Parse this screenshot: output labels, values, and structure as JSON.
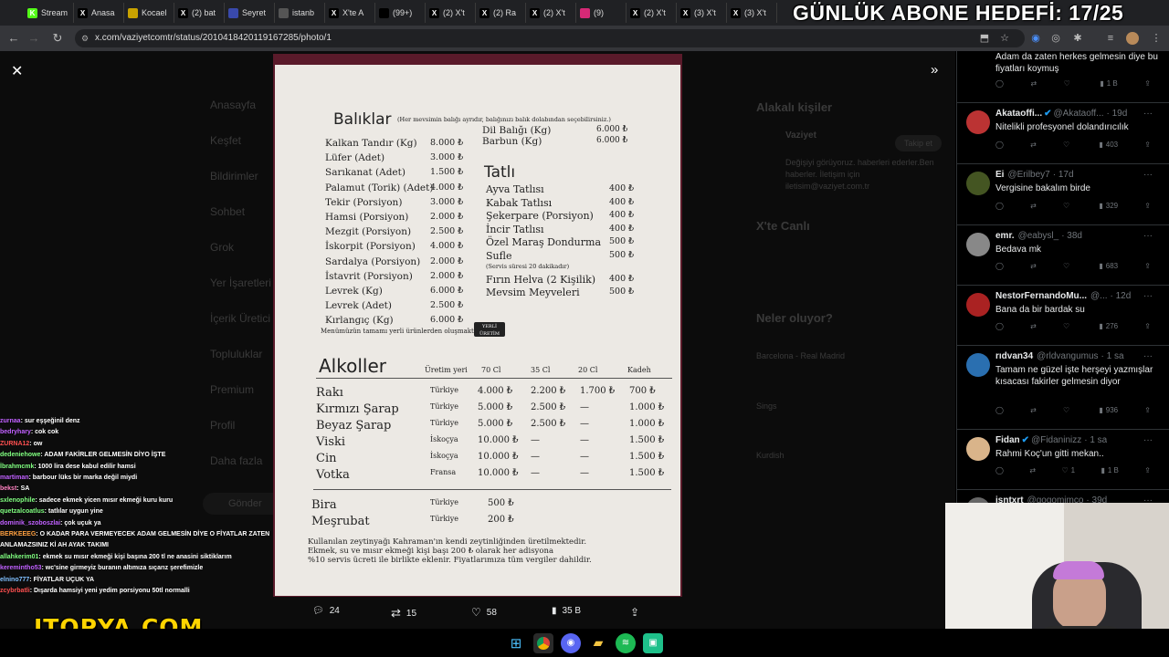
{
  "browser": {
    "tabs": [
      {
        "label": "Stream",
        "icon": "kick-icon",
        "color": "#53fc18"
      },
      {
        "label": "Anasa",
        "icon": "x-icon",
        "color": "#000"
      },
      {
        "label": "Kocael",
        "icon": "shield-icon",
        "color": "#c8a200"
      },
      {
        "label": "(2) bat",
        "icon": "x-icon",
        "color": "#000"
      },
      {
        "label": "Seyret",
        "icon": "globe-icon",
        "color": "#3949ab"
      },
      {
        "label": "istanb",
        "icon": "globe-icon",
        "color": "#555"
      },
      {
        "label": "X'te A",
        "icon": "x-icon",
        "color": "#000"
      },
      {
        "label": "(99+)",
        "icon": "tiktok-icon",
        "color": "#000"
      },
      {
        "label": "(2) X't",
        "icon": "x-icon",
        "color": "#000"
      },
      {
        "label": "(2) Ra",
        "icon": "x-icon",
        "color": "#000"
      },
      {
        "label": "(2) X't",
        "icon": "x-icon",
        "color": "#000"
      },
      {
        "label": "(9)",
        "icon": "instagram-icon",
        "color": "#d62976"
      },
      {
        "label": "(2) X't",
        "icon": "x-icon",
        "color": "#000"
      },
      {
        "label": "(3) X't",
        "icon": "x-icon",
        "color": "#000"
      },
      {
        "label": "(3) X't",
        "icon": "x-icon",
        "color": "#000"
      }
    ],
    "url": "x.com/vaziyetcomtr/status/2010418420119167285/photo/1"
  },
  "overlay_title": "GÜNLÜK ABONE HEDEFİ: 17/25",
  "background": {
    "nav": [
      "Anasayfa",
      "Keşfet",
      "Bildirimler",
      "Sohbet",
      "Grok",
      "Yer İşaretleri",
      "İçerik Üretici",
      "Topluluklar",
      "Premium",
      "Profil",
      "Daha fazla"
    ],
    "post_button": "Gönder",
    "related_title": "Alakalı kişiler",
    "live_title": "X'te Canlı",
    "trends_title": "Neler oluyor?",
    "trend_1": "Barcelona - Real Madrid",
    "trend_2": "Sings",
    "trend_3": "Kurdish",
    "related_name": "Vaziyet",
    "related_desc": "Değişiyi görüyoruz. haberleri ederler.Ben haberler. İletişim için iletisim@vaziyet.com.tr",
    "follow_btn": "Takip et"
  },
  "menu": {
    "fish_title": "Balıklar",
    "fish_note": "(Her mevsimin balığı ayrıdır, balığınızı balık dolabından seçebilirsiniz.)",
    "fish": [
      {
        "name": "Kalkan Tandır (Kg)",
        "price": "8.000 ₺"
      },
      {
        "name": "Lüfer (Adet)",
        "price": "3.000 ₺"
      },
      {
        "name": "Sarıkanat (Adet)",
        "price": "1.500 ₺"
      },
      {
        "name": "Palamut (Torik) (Adet)",
        "price": "4.000 ₺"
      },
      {
        "name": "Tekir (Porsiyon)",
        "price": "3.000 ₺"
      },
      {
        "name": "Hamsi (Porsiyon)",
        "price": "2.000 ₺"
      },
      {
        "name": "Mezgit (Porsiyon)",
        "price": "2.500 ₺"
      },
      {
        "name": "İskorpit (Porsiyon)",
        "price": "4.000 ₺"
      },
      {
        "name": "Sardalya (Porsiyon)",
        "price": "2.000 ₺"
      },
      {
        "name": "İstavrit (Porsiyon)",
        "price": "2.000 ₺"
      },
      {
        "name": "Levrek (Kg)",
        "price": "6.000 ₺"
      },
      {
        "name": "Levrek (Adet)",
        "price": "2.500 ₺"
      },
      {
        "name": "Kırlangıç (Kg)",
        "price": "6.000 ₺"
      }
    ],
    "fish_right": [
      {
        "name": "Dil Balığı (Kg)",
        "price": "6.000 ₺"
      },
      {
        "name": "Barbun (Kg)",
        "price": "6.000 ₺"
      }
    ],
    "dessert_title": "Tatlı",
    "desserts": [
      {
        "name": "Ayva Tatlısı",
        "price": "400 ₺"
      },
      {
        "name": "Kabak Tatlısı",
        "price": "400 ₺"
      },
      {
        "name": "Şekerpare (Porsiyon)",
        "price": "400 ₺"
      },
      {
        "name": "İncir Tatlısı",
        "price": "400 ₺"
      },
      {
        "name": "Özel Maraş Dondurma",
        "price": "500 ₺"
      },
      {
        "name": "Sufle",
        "price": "500 ₺"
      },
      {
        "name": "(Servis süresi 20 dakikadır)",
        "price": ""
      },
      {
        "name": "Fırın Helva (2 Kişilik)",
        "price": "400 ₺"
      },
      {
        "name": "Mevsim Meyveleri",
        "price": "500 ₺"
      }
    ],
    "local_note": "Menümüzün tamamı yerli ürünlerden oluşmaktadır.",
    "local_badge": "YERLİ ÜRETİM",
    "alcohol_title": "Alkoller",
    "alcohol_headers": [
      "Üretim yeri",
      "70 Cl",
      "35 Cl",
      "20 Cl",
      "Kadeh"
    ],
    "alcohol": [
      {
        "name": "Rakı",
        "origin": "Türkiye",
        "c70": "4.000 ₺",
        "c35": "2.200 ₺",
        "c20": "1.700 ₺",
        "glass": "700 ₺"
      },
      {
        "name": "Kırmızı Şarap",
        "origin": "Türkiye",
        "c70": "5.000 ₺",
        "c35": "2.500 ₺",
        "c20": "—",
        "glass": "1.000 ₺"
      },
      {
        "name": "Beyaz Şarap",
        "origin": "Türkiye",
        "c70": "5.000 ₺",
        "c35": "2.500 ₺",
        "c20": "—",
        "glass": "1.000 ₺"
      },
      {
        "name": "Viski",
        "origin": "İskoçya",
        "c70": "10.000 ₺",
        "c35": "—",
        "c20": "—",
        "glass": "1.500 ₺"
      },
      {
        "name": "Cin",
        "origin": "İskoçya",
        "c70": "10.000 ₺",
        "c35": "—",
        "c20": "—",
        "glass": "1.500 ₺"
      },
      {
        "name": "Votka",
        "origin": "Fransa",
        "c70": "10.000 ₺",
        "c35": "—",
        "c20": "—",
        "glass": "1.500 ₺"
      }
    ],
    "drinks": [
      {
        "name": "Bira",
        "origin": "Türkiye",
        "price": "500 ₺"
      },
      {
        "name": "Meşrubat",
        "origin": "Türkiye",
        "price": "200 ₺"
      }
    ],
    "footer": [
      "Kullanılan zeytinyağı Kahraman'ın kendi zeytinliğinden üretilmektedir.",
      "Ekmek, su ve mısır ekmeği kişi başı 200 ₺ olarak her adisyona",
      "%10 servis ücreti ile birlikte eklenir. Fiyatlarımıza tüm vergiler dahildir."
    ]
  },
  "post_actions": {
    "replies": "24",
    "reposts": "15",
    "likes": "58",
    "views": "35 B"
  },
  "replies": [
    {
      "name": "",
      "handle": "",
      "time": "",
      "text": "Adam da zaten herkes gelmesin diye bu fiyatları koymuş",
      "views": "1 B",
      "likes": "",
      "av": "#444"
    },
    {
      "name": "Akataoffi...",
      "handle": "@Akataoff...",
      "time": "· 19d",
      "text": "Nitelikli profesyonel dolandırıcılık",
      "views": "403",
      "likes": "",
      "av": "#b33"
    },
    {
      "name": "Ei",
      "handle": "@Erilbey7",
      "time": "· 17d",
      "text": "Vergisine bakalım birde",
      "views": "329",
      "likes": "",
      "av": "#445522"
    },
    {
      "name": "emr.",
      "handle": "@eabysl_",
      "time": "· 38d",
      "text": "Bedava mk",
      "views": "683",
      "likes": "",
      "av": "#888"
    },
    {
      "name": "NestorFernandoMu...",
      "handle": "@...",
      "time": "· 12d",
      "text": "Bana da bir bardak su",
      "views": "276",
      "likes": "",
      "av": "#a22"
    },
    {
      "name": "rıdvan34",
      "handle": "@rldvangumus",
      "time": "· 1 sa",
      "text": "Tamam ne güzel işte herşeyi yazmışlar kısacası fakirler gelmesin diyor",
      "views": "936",
      "likes": "",
      "av": "#2a6fb0"
    },
    {
      "name": "Fidan",
      "handle": "@Fidaninizz",
      "time": "· 1 sa",
      "text": "Rahmi Koç'un gitti mekan..",
      "views": "1 B",
      "likes": "1",
      "av": "#d9b48a"
    },
    {
      "name": "isntxrt",
      "handle": "@gogomimco",
      "time": "· 39d",
      "text": "",
      "views": "",
      "likes": "",
      "av": "#666"
    }
  ],
  "chat": [
    {
      "user": "zurnaa",
      "text": ": sur eşşeğinil denz",
      "color": "#c060ff"
    },
    {
      "user": "bedryhary",
      "text": ": cok cok",
      "color": "#c060ff"
    },
    {
      "user": "ZURNA12",
      "text": ": ow",
      "color": "#ff5050"
    },
    {
      "user": "dedeniehowe",
      "text": ": ADAM FAKİRLER GELMESİN DİYO İŞTE",
      "color": "#80ff80"
    },
    {
      "user": "İbrahmcmk",
      "text": ": 1000 lira dese kabul edilir hamsi",
      "color": "#80ff80"
    },
    {
      "user": "martiman",
      "text": ": barbour lüks bir marka değil miydi",
      "color": "#c060ff"
    },
    {
      "user": "bekst",
      "text": ": SA",
      "color": "#ff80c0"
    },
    {
      "user": "sxlenophile",
      "text": ": sadece ekmek yicen mısır ekmeği kuru kuru",
      "color": "#80ff80"
    },
    {
      "user": "quetzalcoatlus",
      "text": ": tatlılar uygun yine",
      "color": "#80ff80"
    },
    {
      "user": "dominik_szoboszlai",
      "text": ": çok uçuk ya",
      "color": "#c060ff"
    },
    {
      "user": "BERKEEEG",
      "text": ": O KADAR PARA VERMEYECEK ADAM GELMESİN DİYE O FİYATLAR ZATEN ANLAMAZSINIZ Kİ AH AYAK TAKIMI",
      "color": "#ffa040"
    },
    {
      "user": "allahkerim01",
      "text": ": ekmek su mısır ekmeği kişi başına 200 tl ne anasini siktiklarım",
      "color": "#80ff80"
    },
    {
      "user": "keremintho53",
      "text": ": wc'sine girmeyiz buranın altımıza sıçarız şerefimizle",
      "color": "#c060ff"
    },
    {
      "user": "elnino777",
      "text": ": FİYATLAR UÇUK YA",
      "color": "#80c0ff"
    },
    {
      "user": "zcybrbatli",
      "text": ": Dışarda hamsiyi yeni yedim porsiyonu 50tl normalli",
      "color": "#ff5050"
    }
  ],
  "logo": "ITOPYA.COM",
  "colors": {
    "accent": "#1d9bf0",
    "verified": "#1d9bf0",
    "page": "#000000",
    "logo": "#ffd400"
  }
}
